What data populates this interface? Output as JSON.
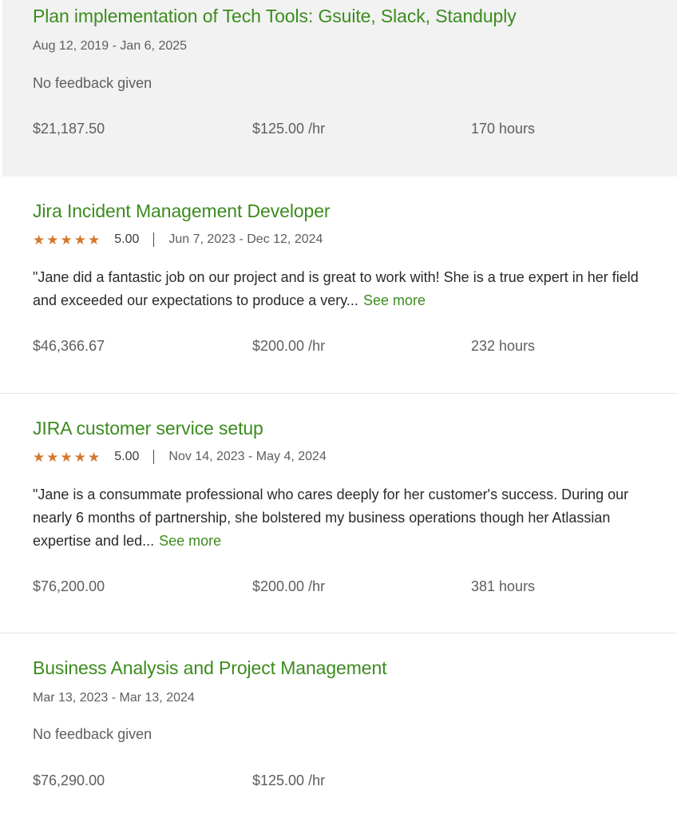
{
  "colors": {
    "title_green": "#3c8c1e",
    "star_orange": "#d3782f",
    "highlight_bg": "#f2f2f2"
  },
  "jobs": [
    {
      "title": "Plan implementation of Tech Tools: Gsuite, Slack, Standuply",
      "dates": "Aug 12, 2019 - Jan 6, 2025",
      "feedback": "No feedback given",
      "earned": "$21,187.50",
      "rate": "$125.00 /hr",
      "hours": "170 hours"
    },
    {
      "title": "Jira Incident Management Developer",
      "stars": 5,
      "rating": "5.00",
      "dates": "Jun 7, 2023 - Dec 12, 2024",
      "feedback": "\"Jane did a fantastic job on our project and is great to work with! She is a true expert in her field and exceeded our expectations to produce a very...",
      "see_more": "See more",
      "earned": "$46,366.67",
      "rate": "$200.00 /hr",
      "hours": "232 hours"
    },
    {
      "title": "JIRA customer service setup",
      "stars": 5,
      "rating": "5.00",
      "dates": "Nov 14, 2023 - May 4, 2024",
      "feedback": "\"Jane is a consummate professional who cares deeply for her customer's success. During our nearly 6 months of partnership, she bolstered my business operations though her Atlassian expertise and led...",
      "see_more": "See more",
      "earned": "$76,200.00",
      "rate": "$200.00 /hr",
      "hours": "381 hours"
    },
    {
      "title": "Business Analysis and Project Management",
      "dates": "Mar 13, 2023 - Mar 13, 2024",
      "feedback": "No feedback given",
      "earned": "$76,290.00",
      "rate": "$125.00 /hr"
    }
  ]
}
